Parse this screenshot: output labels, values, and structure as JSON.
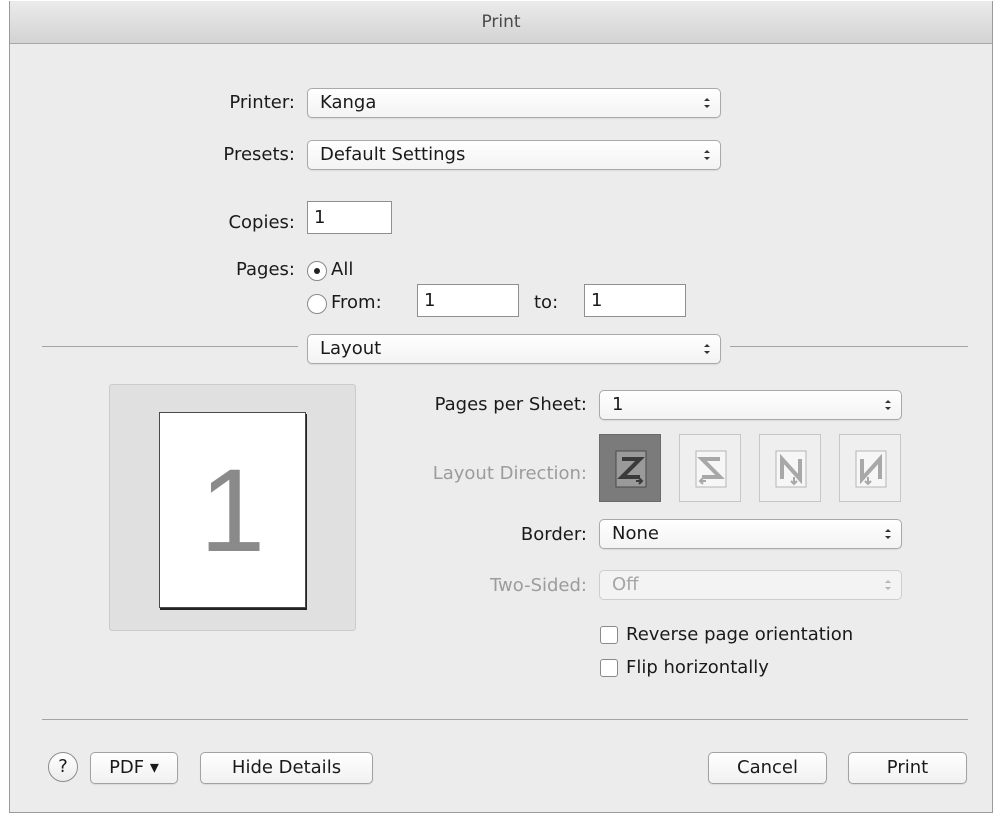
{
  "window": {
    "title": "Print"
  },
  "printer": {
    "label": "Printer:",
    "value": "Kanga"
  },
  "presets": {
    "label": "Presets:",
    "value": "Default Settings"
  },
  "copies": {
    "label": "Copies:",
    "value": "1"
  },
  "pages": {
    "label": "Pages:",
    "all_label": "All",
    "from_label": "From:",
    "from_value": "1",
    "to_label": "to:",
    "to_value": "1",
    "selected": "All"
  },
  "section": {
    "value": "Layout"
  },
  "preview": {
    "page_number": "1"
  },
  "layout": {
    "pages_per_sheet_label": "Pages per Sheet:",
    "pages_per_sheet_value": "1",
    "direction_label": "Layout Direction:",
    "direction_options": [
      "z-left-right-icon",
      "s-right-left-icon",
      "n-top-down-icon",
      "n-mirrored-top-down-icon"
    ],
    "border_label": "Border:",
    "border_value": "None",
    "two_sided_label": "Two-Sided:",
    "two_sided_value": "Off",
    "reverse_label": "Reverse page orientation",
    "flip_label": "Flip horizontally"
  },
  "footer": {
    "help_label": "?",
    "pdf_label": "PDF ▾",
    "hide_details_label": "Hide Details",
    "cancel_label": "Cancel",
    "print_label": "Print"
  }
}
